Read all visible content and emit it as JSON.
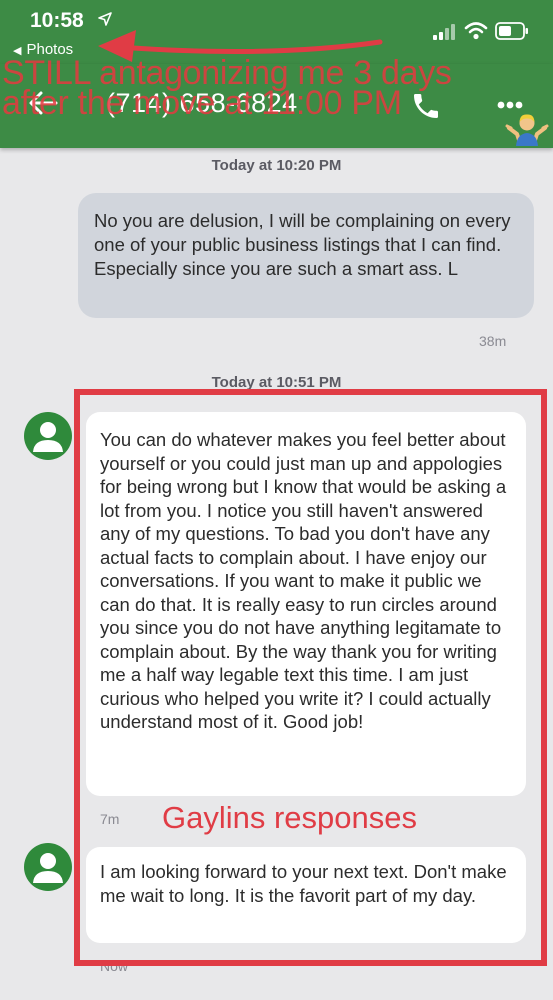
{
  "status": {
    "time": "10:58",
    "back_label": "Photos"
  },
  "header": {
    "title": "(714) 658-6824"
  },
  "overlay": {
    "caption_line1": "STILL antagonizing me 3 days",
    "caption_line2": "after the move at 11:00 PM",
    "annotation_label": "Gaylins responses"
  },
  "thread": {
    "date1": "Today at 10:20 PM",
    "msg_out_1": "No you are delusion, I will be complaining on every one of your public business listings that I can find. Especially since you are such a smart ass. L",
    "time1": "38m",
    "date2": "Today at 10:51 PM",
    "msg_in_1": "You can do whatever makes you feel better about yourself or you could just man up and appologies for being wrong but I know that would be asking a lot from you.  I notice you still haven't answered any of my questions. To bad you don't have any actual facts to complain about.  I have enjoy our conversations.  If you want to make it public we can do that.  It is really easy to run circles around you since you do not have anything legitamate to complain about.  By the way thank you for writing me a half way legable text this time.  I am just curious who helped you write it?  I could actually understand most of it. Good job!",
    "time2": "7m",
    "msg_in_2": "I am looking forward to your next text.  Don't make me wait to long.  It is the favorit part of my day.",
    "time3": "Now"
  },
  "icons": [
    "location-arrow-icon",
    "signal-icon",
    "wifi-icon",
    "battery-icon",
    "back-arrow-icon",
    "phone-icon",
    "more-icon",
    "person-icon",
    "shrug-emoji"
  ],
  "colors": {
    "app_bar": "#3d8b45",
    "annotation_red": "#e03c45",
    "avatar_green": "#2f8a3b",
    "outgoing_bubble": "#d1d5dc",
    "background": "#e8e8ea"
  }
}
